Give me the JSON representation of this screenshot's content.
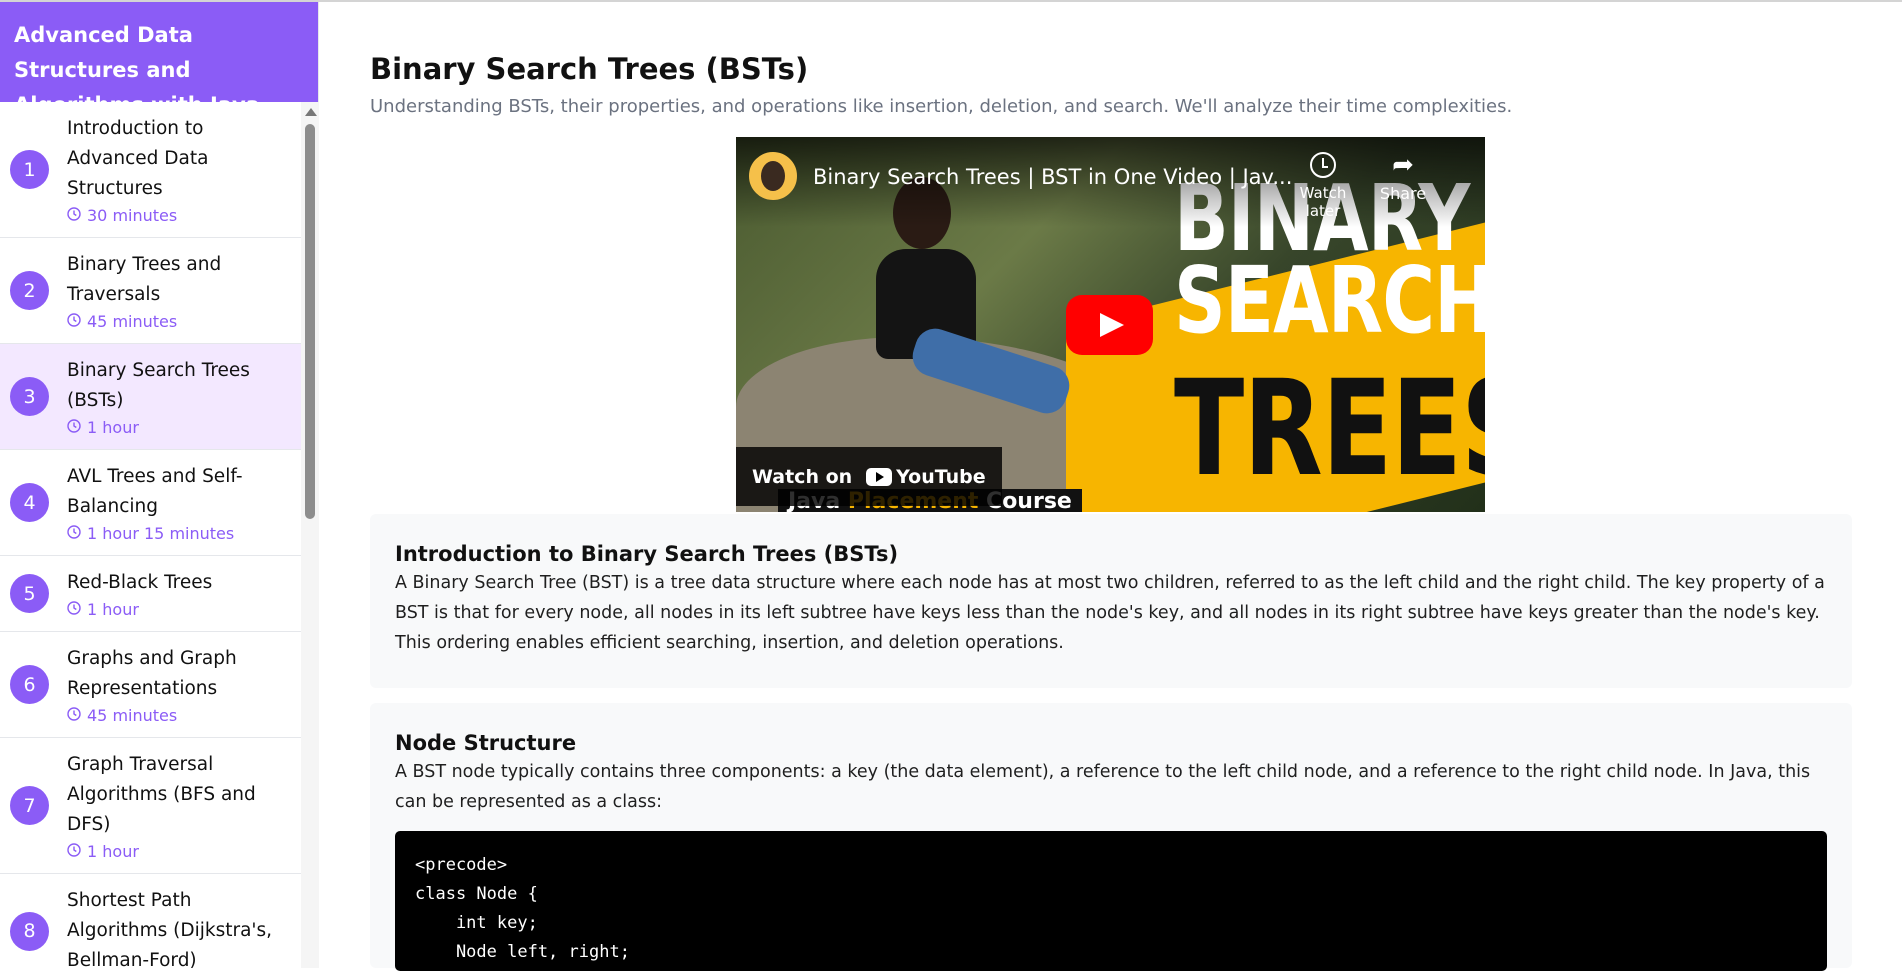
{
  "course": {
    "title": "Advanced Data Structures and Algorithms with Java"
  },
  "lessons": [
    {
      "number": "1",
      "title": "Introduction to Advanced Data Structures",
      "duration": "30 minutes"
    },
    {
      "number": "2",
      "title": "Binary Trees and Traversals",
      "duration": "45 minutes"
    },
    {
      "number": "3",
      "title": "Binary Search Trees (BSTs)",
      "duration": "1 hour",
      "active": true
    },
    {
      "number": "4",
      "title": "AVL Trees and Self-Balancing",
      "duration": "1 hour 15 minutes"
    },
    {
      "number": "5",
      "title": "Red-Black Trees",
      "duration": "1 hour"
    },
    {
      "number": "6",
      "title": "Graphs and Graph Representations",
      "duration": "45 minutes"
    },
    {
      "number": "7",
      "title": "Graph Traversal Algorithms (BFS and DFS)",
      "duration": "1 hour"
    },
    {
      "number": "8",
      "title": "Shortest Path Algorithms (Dijkstra's, Bellman-Ford)",
      "duration": ""
    }
  ],
  "page": {
    "title": "Binary Search Trees (BSTs)",
    "subtitle": "Understanding BSTs, their properties, and operations like insertion, deletion, and search. We'll analyze their time complexities."
  },
  "video": {
    "title": "Binary Search Trees | BST in One Video | Jav...",
    "watch_later": "Watch later",
    "share": "Share",
    "watch_on": "Watch on",
    "youtube": "YouTube",
    "thumb_word1": "BINARY",
    "thumb_word2": "SEARCH",
    "thumb_word3": "TREES",
    "thumb_tag_a": "Java ",
    "thumb_tag_b": "Placement",
    "thumb_tag_c": " Course"
  },
  "sections": [
    {
      "heading": "Introduction to Binary Search Trees (BSTs)",
      "body": "A Binary Search Tree (BST) is a tree data structure where each node has at most two children, referred to as the left child and the right child. The key property of a BST is that for every node, all nodes in its left subtree have keys less than the node's key, and all nodes in its right subtree have keys greater than the node's key. This ordering enables efficient searching, insertion, and deletion operations."
    },
    {
      "heading": "Node Structure",
      "body": "A BST node typically contains three components: a key (the data element), a reference to the left child node, and a reference to the right child node. In Java, this can be represented as a class:",
      "code": "<precode>\nclass Node {\n    int key;\n    Node left, right;"
    }
  ]
}
